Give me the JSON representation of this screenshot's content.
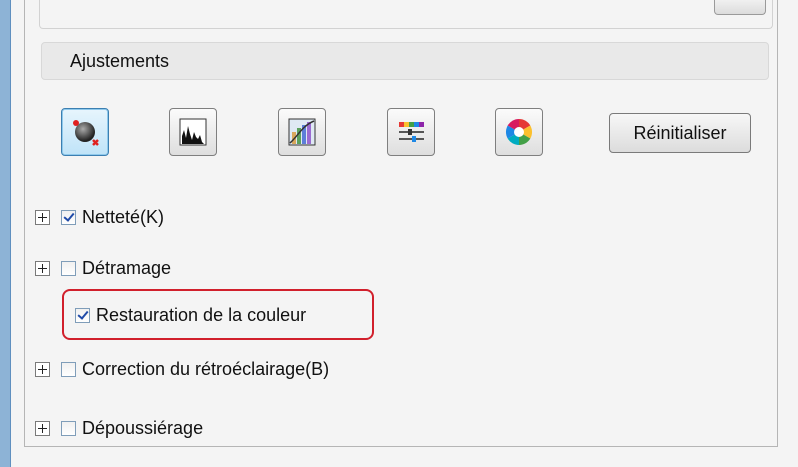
{
  "panel": {
    "section_title": "Ajustements",
    "reset_button": "Réinitialiser",
    "tools": [
      {
        "icon": "auto-exposure-icon",
        "active": true
      },
      {
        "icon": "histogram-icon",
        "active": false
      },
      {
        "icon": "tone-curve-icon",
        "active": false
      },
      {
        "icon": "color-palette-icon",
        "active": false
      },
      {
        "icon": "color-wheel-icon",
        "active": false
      }
    ],
    "options": [
      {
        "label": "Netteté(K)",
        "checked": true,
        "expandable": true
      },
      {
        "label": "Détramage",
        "checked": false,
        "expandable": true
      },
      {
        "label": "Restauration de la couleur",
        "checked": true,
        "expandable": false
      },
      {
        "label": "Correction du rétroéclairage(B)",
        "checked": false,
        "expandable": true
      },
      {
        "label": "Dépoussiérage",
        "checked": false,
        "expandable": true
      }
    ],
    "highlight_color": "#d1202c",
    "active_tool_color": "#bfe3f8"
  }
}
